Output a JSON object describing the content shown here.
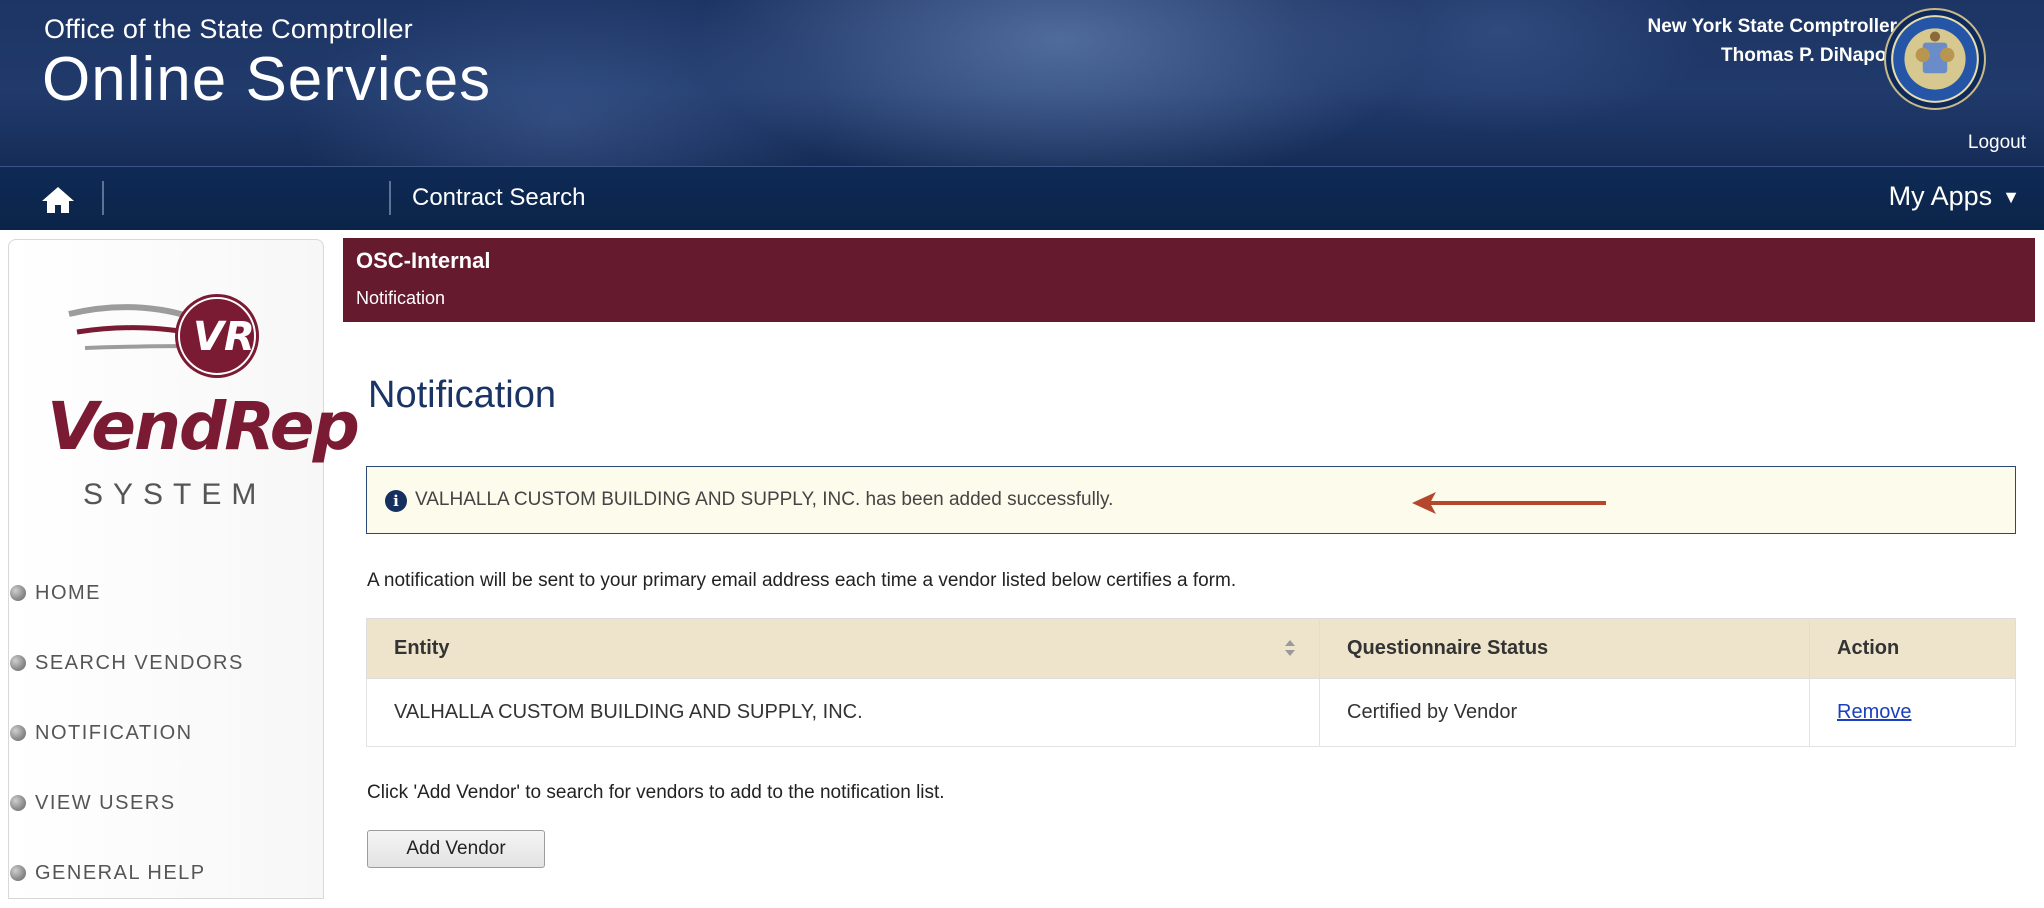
{
  "header": {
    "office_line": "Office of the State Comptroller",
    "app_name": "Online Services",
    "comptroller_title": "New York State Comptroller",
    "comptroller_name": "Thomas P. DiNapoli",
    "logout_label": "Logout"
  },
  "navbar": {
    "home_icon": "home-icon",
    "contract_search_label": "Contract Search",
    "my_apps_label": "My Apps",
    "my_apps_caret": "▼"
  },
  "sidebar": {
    "logo_text": "VendRep",
    "logo_subtext": "SYSTEM",
    "logo_badge": "VR",
    "items": [
      {
        "label": "HOME"
      },
      {
        "label": "SEARCH VENDORS"
      },
      {
        "label": "NOTIFICATION"
      },
      {
        "label": "VIEW USERS"
      },
      {
        "label": "GENERAL HELP"
      }
    ]
  },
  "context_bar": {
    "title": "OSC-Internal",
    "subtitle": "Notification"
  },
  "main": {
    "page_title": "Notification",
    "alert_message": "VALHALLA CUSTOM BUILDING AND SUPPLY, INC. has been added successfully.",
    "notice_text": "A notification will be sent to your primary email address each time a vendor listed below certifies a form.",
    "table": {
      "headers": [
        "Entity",
        "Questionnaire Status",
        "Action"
      ],
      "rows": [
        {
          "entity": "VALHALLA CUSTOM BUILDING AND SUPPLY, INC.",
          "status": "Certified by Vendor",
          "action": "Remove"
        }
      ]
    },
    "click_text": "Click 'Add Vendor' to search for vendors to add to the notification list.",
    "add_vendor_label": "Add Vendor"
  },
  "colors": {
    "banner": "#1d3564",
    "navbar": "#0e2a55",
    "context_bar": "#651a2e",
    "alert_bg": "#fcfbec",
    "table_header": "#ede4cb",
    "link": "#1a3fbf",
    "annotation_arrow": "#b5472e"
  }
}
